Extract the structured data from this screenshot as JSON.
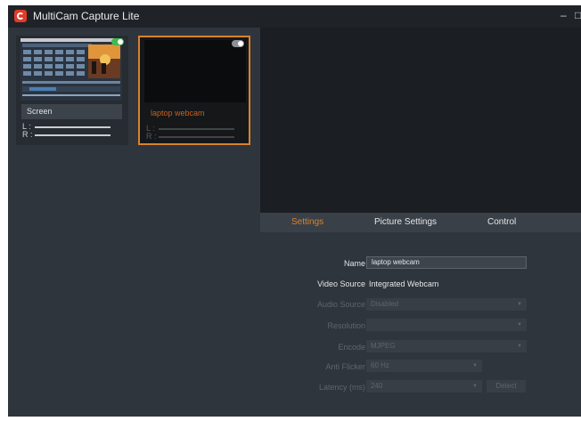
{
  "app": {
    "title": "MultiCam Capture Lite",
    "minimize_glyph": "–",
    "maximize_glyph": "□"
  },
  "sources": [
    {
      "name": "Screen",
      "selected": false,
      "enabled": true,
      "meters": {
        "left": "L :",
        "right": "R :"
      },
      "toggle_color": "#3fb950"
    },
    {
      "name": "laptop webcam",
      "selected": true,
      "enabled": true,
      "meters": {
        "left": "L :",
        "right": "R :"
      },
      "toggle_color": "#8b9197"
    }
  ],
  "tabs": [
    {
      "label": "Settings",
      "active": true
    },
    {
      "label": "Picture Settings",
      "active": false
    },
    {
      "label": "Control",
      "active": false
    }
  ],
  "settings": {
    "name_label": "Name",
    "name_value": "laptop webcam",
    "video_source_label": "Video Source",
    "video_source_value": "Integrated Webcam",
    "audio_source_label": "Audio Source",
    "audio_source_value": "Disabled",
    "resolution_label": "Resolution",
    "resolution_value": "",
    "encode_label": "Encode",
    "encode_value": "MJPEG",
    "anti_flicker_label": "Anti Flicker",
    "anti_flicker_value": "60 Hz",
    "latency_label": "Latency (ms)",
    "latency_value": "240",
    "detect_label": "Detect"
  },
  "colors": {
    "accent": "#d9822b",
    "panel": "#2f353c",
    "titlebar": "#1f2328",
    "preview": "#1b1e22",
    "brand_red": "#e23b2a"
  },
  "icons": {
    "app_logo": "multicam-logo-icon",
    "dropdown": "chevron-down-icon"
  }
}
